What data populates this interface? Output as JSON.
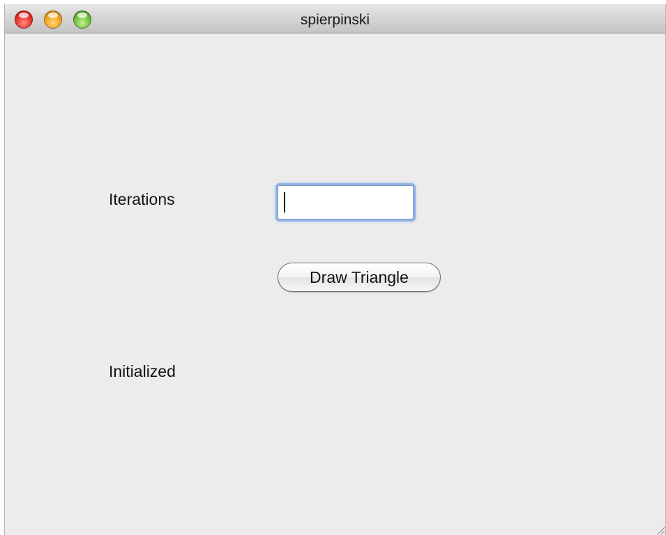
{
  "window": {
    "title": "spierpinski"
  },
  "form": {
    "iterations_label": "Iterations",
    "iterations_value": "",
    "draw_button_label": "Draw Triangle",
    "status_text": "Initialized"
  },
  "icons": {
    "close": "close-icon",
    "minimize": "minimize-icon",
    "zoom": "zoom-icon",
    "resize": "resize-grip-icon"
  },
  "colors": {
    "window_background": "#ececec",
    "focus_ring": "#8fb3e6",
    "close": "#e3322a",
    "minimize": "#f1a21f",
    "zoom": "#6cbd3a"
  }
}
